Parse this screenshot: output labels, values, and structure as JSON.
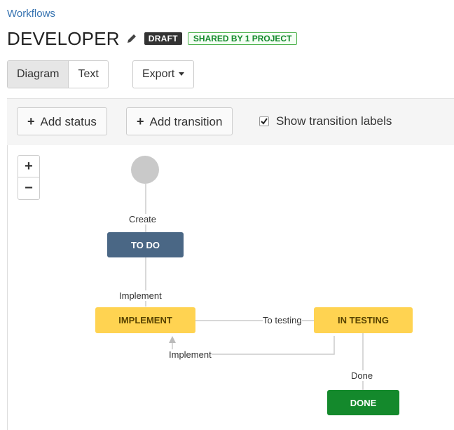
{
  "breadcrumb": "Workflows",
  "title": "DEVELOPER",
  "badges": {
    "draft": "DRAFT",
    "shared": "SHARED BY 1 PROJECT"
  },
  "view_tabs": {
    "diagram": "Diagram",
    "text": "Text"
  },
  "export_label": "Export",
  "toolbar": {
    "add_status": "Add status",
    "add_transition": "Add transition",
    "show_labels": "Show transition labels",
    "show_labels_checked": true
  },
  "zoom": {
    "in": "+",
    "out": "−"
  },
  "statuses": {
    "todo": "TO DO",
    "implement": "IMPLEMENT",
    "in_testing": "IN TESTING",
    "done": "DONE"
  },
  "transitions": {
    "create": "Create",
    "implement_1": "Implement",
    "to_testing": "To testing",
    "implement_2": "Implement",
    "done": "Done"
  },
  "colors": {
    "link": "#3572b0",
    "todo": "#4a6785",
    "in_progress": "#ffd351",
    "done": "#14892c",
    "start": "#c9c9c9"
  }
}
